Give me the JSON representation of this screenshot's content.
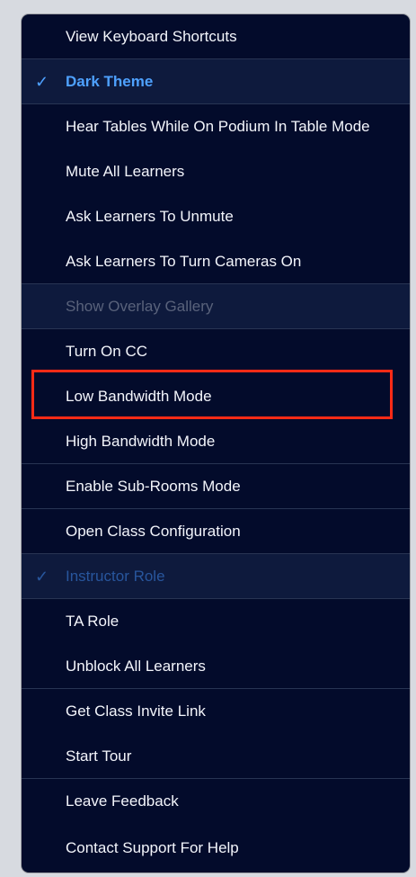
{
  "menu": {
    "items": [
      {
        "label": "View Keyboard Shortcuts"
      },
      {
        "label": "Dark Theme",
        "checked": true
      },
      {
        "label": "Hear Tables While On Podium In Table Mode"
      },
      {
        "label": "Mute All Learners"
      },
      {
        "label": "Ask Learners To Unmute"
      },
      {
        "label": "Ask Learners To Turn Cameras On"
      },
      {
        "label": "Show Overlay Gallery",
        "disabled": true
      },
      {
        "label": "Turn On CC"
      },
      {
        "label": "Low Bandwidth Mode",
        "highlighted_by_red_box": true
      },
      {
        "label": "High Bandwidth Mode"
      },
      {
        "label": "Enable Sub-Rooms Mode"
      },
      {
        "label": "Open Class Configuration"
      },
      {
        "label": "Instructor Role",
        "checked": true,
        "disabled": true
      },
      {
        "label": "TA Role"
      },
      {
        "label": "Unblock All Learners"
      },
      {
        "label": "Get Class Invite Link"
      },
      {
        "label": "Start Tour"
      },
      {
        "label": "Leave Feedback"
      },
      {
        "label": "Contact Support For Help"
      }
    ],
    "check_glyph": "✓"
  },
  "colors": {
    "menu_bg": "#030b2b",
    "accent": "#4ea1ff",
    "disabled_text": "#59627b",
    "selection_outline": "#ff2b16"
  }
}
